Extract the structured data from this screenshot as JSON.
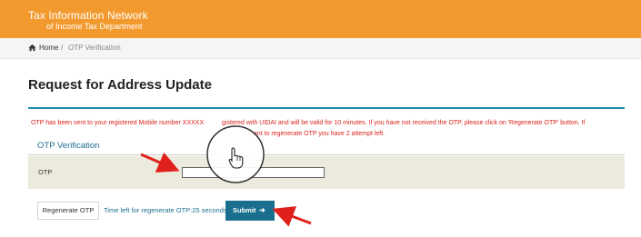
{
  "header": {
    "title": "Tax Information Network",
    "subtitle": "of Income Tax Department"
  },
  "breadcrumb": {
    "home": "Home",
    "separator": "/",
    "current": "OTP Verification"
  },
  "page": {
    "title": "Request for Address Update"
  },
  "alert": {
    "line1_part1": "OTP has been sent to your registered Mobile number XXXXX",
    "line1_part2": "gistered with UIDAI and will be valid for 10 minutes. If you have not received the OTP, please click on 'Regenerate OTP' button. If",
    "line2": "u want to regenerate OTP you have 2 attempt left."
  },
  "form": {
    "section_title": "OTP Verification",
    "otp_label": "OTP",
    "otp_value": "",
    "otp_placeholder": ""
  },
  "actions": {
    "regenerate_label": "Regenerate OTP",
    "timer_text": "Time left for regenerate OTP:25 seconds",
    "submit_label": "Submit",
    "submit_icon": "arrow-right-icon"
  },
  "colors": {
    "header_bg": "#f39a2f",
    "accent": "#1a6f8e",
    "alert_text": "#d9221c",
    "annotation_arrow": "#e0211b"
  }
}
